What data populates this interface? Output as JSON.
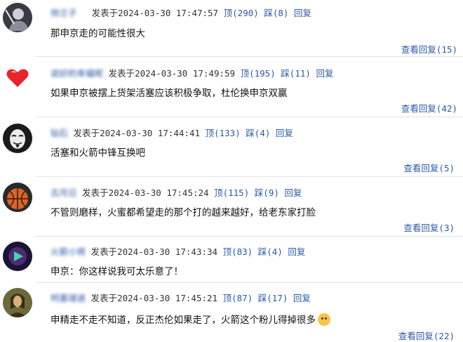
{
  "comments": [
    {
      "user": "帅兰子",
      "posted_label": "发表于",
      "datetime": "2024-03-30 17:47:57",
      "up_label": "顶",
      "up_count": "(290)",
      "down_label": "踩",
      "down_count": "(8)",
      "reply_label": "回复",
      "text": "那申京走的可能性很大",
      "view_replies": "查看回复(15)",
      "avatar_icon": "dark-figure-avatar"
    },
    {
      "user": "说好的幸福呢",
      "posted_label": "发表于",
      "datetime": "2024-03-30 17:49:59",
      "up_label": "顶",
      "up_count": "(195)",
      "down_label": "踩",
      "down_count": "(11)",
      "reply_label": "回复",
      "text": "如果申京被摆上货架活塞应该积极争取，杜伦换申京双赢",
      "view_replies": "查看回复(42)",
      "avatar_icon": "red-heart-avatar"
    },
    {
      "user": "钻石",
      "posted_label": "发表于",
      "datetime": "2024-03-30 17:44:41",
      "up_label": "顶",
      "up_count": "(133)",
      "down_label": "踩",
      "down_count": "(4)",
      "reply_label": "回复",
      "text": "活塞和火箭中锋互换吧",
      "view_replies": "查看回复(5)",
      "avatar_icon": "mask-avatar"
    },
    {
      "user": "古月日",
      "posted_label": "发表于",
      "datetime": "2024-03-30 17:45:24",
      "up_label": "顶",
      "up_count": "(115)",
      "down_label": "踩",
      "down_count": "(9)",
      "reply_label": "回复",
      "text": "不管则磨样，火蜜都希望走的那个打的越来越好，给老东家打脸",
      "view_replies": "查看回复(3)",
      "avatar_icon": "basketball-avatar"
    },
    {
      "user": "火箭小将",
      "posted_label": "发表于",
      "datetime": "2024-03-30 17:43:34",
      "up_label": "顶",
      "up_count": "(83)",
      "down_label": "踩",
      "down_count": "(4)",
      "reply_label": "回复",
      "text": "申京：你这样说我可太乐意了！",
      "view_replies": "",
      "avatar_icon": "purple-avatar"
    },
    {
      "user": "柯基球迷",
      "posted_label": "发表于",
      "datetime": "2024-03-30 17:45:21",
      "up_label": "顶",
      "up_count": "(87)",
      "down_label": "踩",
      "down_count": "(17)",
      "reply_label": "回复",
      "text": "申精走不走不知道，反正杰伦如果走了，火箭这个粉儿得掉很多",
      "view_replies": "查看回复(22)",
      "avatar_icon": "mona-lisa-avatar"
    }
  ]
}
